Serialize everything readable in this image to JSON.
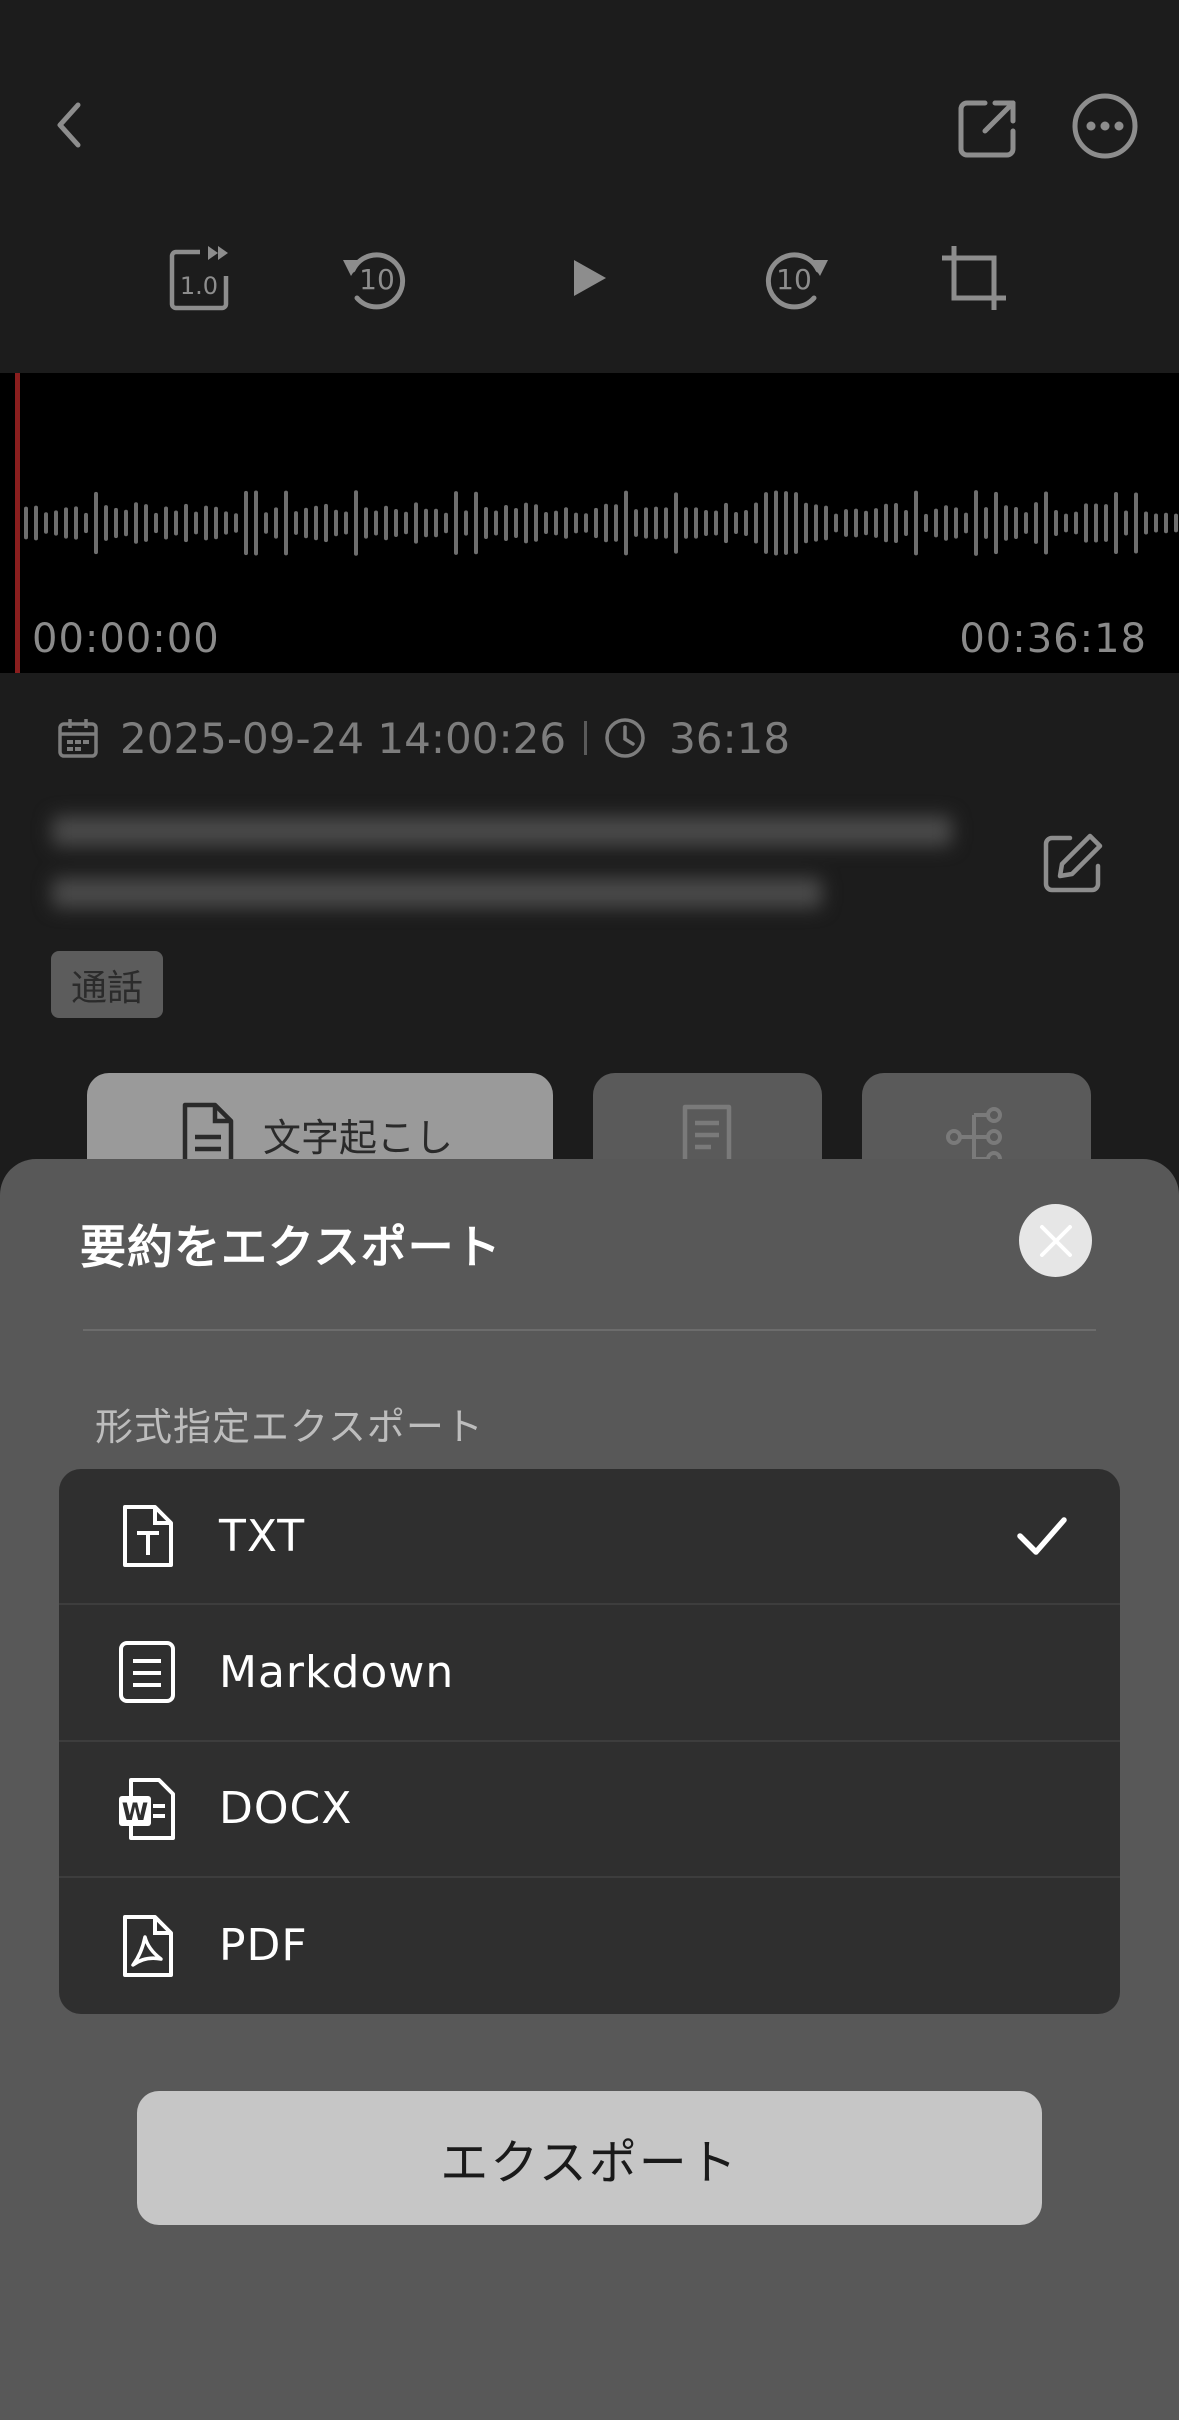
{
  "player": {
    "icons": {
      "back": "chevron-left-icon",
      "share": "share-icon",
      "more": "more-icon",
      "speed": "speed-icon",
      "rewind": "rewind-10-icon",
      "play": "play-icon",
      "forward": "forward-10-icon",
      "crop": "crop-icon"
    },
    "speed_label": "1.0",
    "rewind_label": "10",
    "forward_label": "10",
    "time_start": "00:00:00",
    "time_end": "00:36:18",
    "date": "2025-09-24 14:00:26",
    "duration": "36:18",
    "tag": "通話",
    "transcript_tab_label": "文字起こし"
  },
  "sheet": {
    "title": "要約をエクスポート",
    "section_label": "形式指定エクスポート",
    "formats": [
      {
        "label": "TXT",
        "icon": "txt-file-icon",
        "selected": true
      },
      {
        "label": "Markdown",
        "icon": "markdown-file-icon",
        "selected": false
      },
      {
        "label": "DOCX",
        "icon": "word-file-icon",
        "selected": false
      },
      {
        "label": "PDF",
        "icon": "pdf-file-icon",
        "selected": false
      }
    ],
    "export_label": "エクスポート"
  },
  "colors": {
    "sheet_background": "#585858",
    "list_background": "#2f2f2f",
    "playhead": "#8a1e1e",
    "export_button": "#c6c6c6"
  }
}
